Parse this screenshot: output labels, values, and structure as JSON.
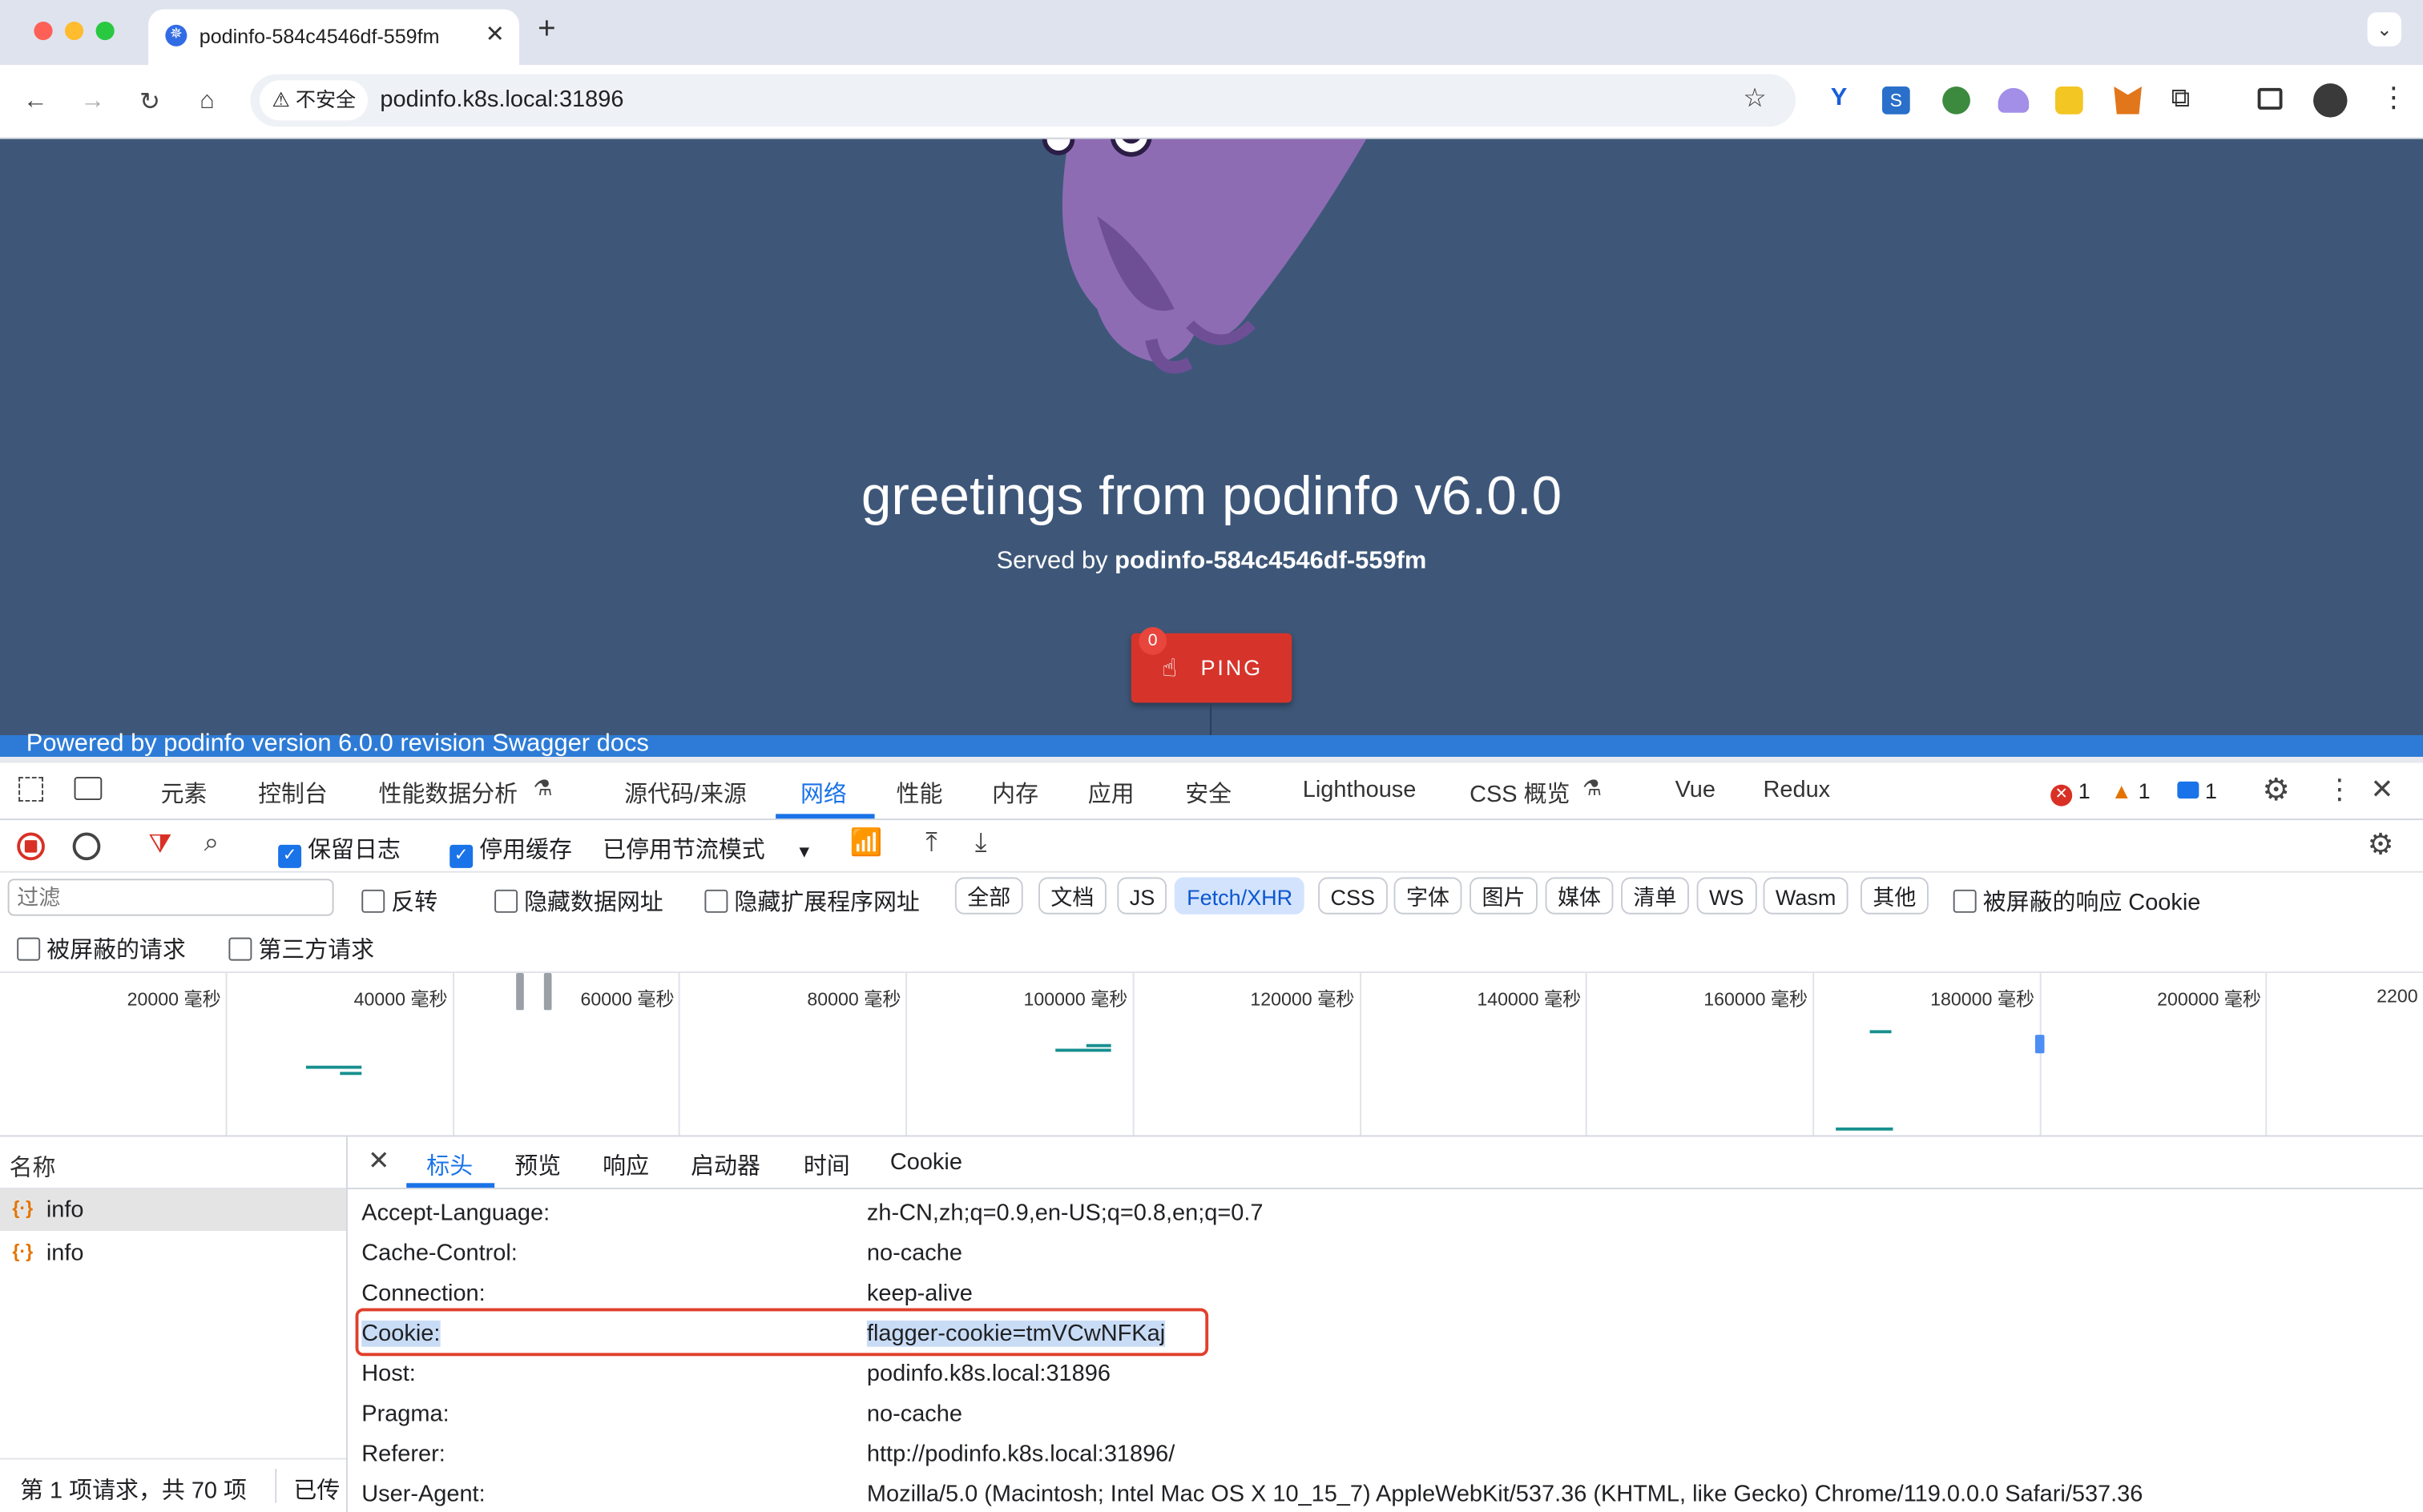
{
  "browser": {
    "tab_title": "podinfo-584c4546df-559fm",
    "security_label": "不安全",
    "url": "podinfo.k8s.local:31896"
  },
  "page": {
    "heading": "greetings from podinfo v6.0.0",
    "served_by_prefix": "Served by ",
    "served_by_pod": "podinfo-584c4546df-559fm",
    "ping_label": "PING",
    "ping_badge": "0",
    "footer": "Powered by podinfo version 6.0.0 revision Swagger docs"
  },
  "devtools": {
    "tabs": [
      "元素",
      "控制台",
      "性能数据分析",
      "源代码/来源",
      "网络",
      "性能",
      "内存",
      "应用",
      "安全",
      "Lighthouse",
      "CSS 概览",
      "Vue",
      "Redux"
    ],
    "error_count": "1",
    "warning_count": "1",
    "info_count": "1",
    "preserve_log_label": "保留日志",
    "disable_cache_label": "停用缓存",
    "throttle_label": "已停用节流模式",
    "filter_placeholder": "过滤",
    "invert_label": "反转",
    "hide_data_urls_label": "隐藏数据网址",
    "hide_ext_urls_label": "隐藏扩展程序网址",
    "type_filters": [
      "全部",
      "文档",
      "JS",
      "Fetch/XHR",
      "CSS",
      "字体",
      "图片",
      "媒体",
      "清单",
      "WS",
      "Wasm",
      "其他"
    ],
    "blocked_cookies_label": "被屏蔽的响应 Cookie",
    "blocked_requests_label": "被屏蔽的请求",
    "third_party_label": "第三方请求",
    "timeline_ticks": [
      "20000 毫秒",
      "40000 毫秒",
      "60000 毫秒",
      "80000 毫秒",
      "100000 毫秒",
      "120000 毫秒",
      "140000 毫秒",
      "160000 毫秒",
      "180000 毫秒",
      "200000 毫秒",
      "2200"
    ],
    "name_column": "名称",
    "requests": [
      "info",
      "info"
    ],
    "status_bar": "第 1 项请求，共 70 项",
    "status_bar_2": "已传",
    "detail_tabs": [
      "标头",
      "预览",
      "响应",
      "启动器",
      "时间",
      "Cookie"
    ],
    "headers": [
      {
        "name": "Accept-Language:",
        "value": "zh-CN,zh;q=0.9,en-US;q=0.8,en;q=0.7"
      },
      {
        "name": "Cache-Control:",
        "value": "no-cache"
      },
      {
        "name": "Connection:",
        "value": "keep-alive"
      },
      {
        "name": "Cookie:",
        "value": "flagger-cookie=tmVCwNFKaj"
      },
      {
        "name": "Host:",
        "value": "podinfo.k8s.local:31896"
      },
      {
        "name": "Pragma:",
        "value": "no-cache"
      },
      {
        "name": "Referer:",
        "value": "http://podinfo.k8s.local:31896/"
      },
      {
        "name": "User-Agent:",
        "value": "Mozilla/5.0 (Macintosh; Intel Mac OS X 10_15_7) AppleWebKit/537.36 (KHTML, like Gecko) Chrome/119.0.0.0 Safari/537.36"
      }
    ]
  },
  "colors": {
    "page_bg": "#3e5779",
    "ping_red": "#d6342b",
    "highlight_red": "#e0402c",
    "devtools_blue": "#1a73e8"
  }
}
